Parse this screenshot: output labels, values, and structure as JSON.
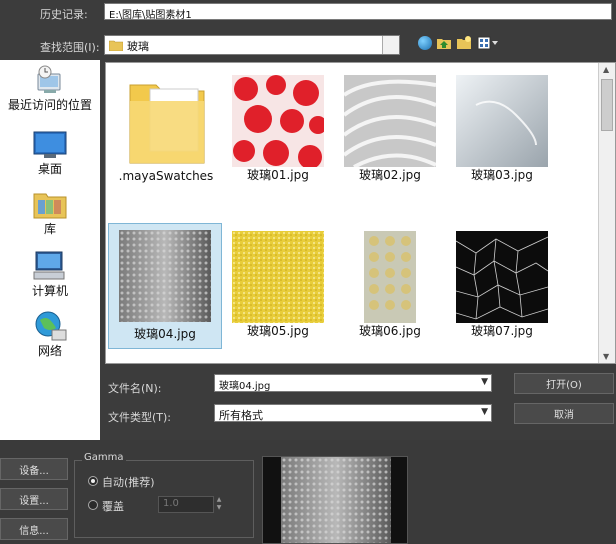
{
  "history": {
    "label": "历史记录:",
    "value": "E:\\图库\\贴图素材1"
  },
  "lookin": {
    "label": "查找范围(I):",
    "value": "玻璃"
  },
  "sidebar": {
    "items": [
      {
        "label": "最近访问的位置",
        "icon": "recent-places-icon"
      },
      {
        "label": "桌面",
        "icon": "desktop-icon"
      },
      {
        "label": "库",
        "icon": "library-icon"
      },
      {
        "label": "计算机",
        "icon": "computer-icon"
      },
      {
        "label": "网络",
        "icon": "network-icon"
      }
    ]
  },
  "files": [
    {
      "name": ".mayaSwatches",
      "kind": "folder"
    },
    {
      "name": "玻璃01.jpg",
      "kind": "image"
    },
    {
      "name": "玻璃02.jpg",
      "kind": "image"
    },
    {
      "name": "玻璃03.jpg",
      "kind": "image"
    },
    {
      "name": "玻璃04.jpg",
      "kind": "image",
      "selected": true
    },
    {
      "name": "玻璃05.jpg",
      "kind": "image"
    },
    {
      "name": "玻璃06.jpg",
      "kind": "image"
    },
    {
      "name": "玻璃07.jpg",
      "kind": "image"
    }
  ],
  "filename": {
    "label": "文件名(N):",
    "value": "玻璃04.jpg"
  },
  "filetype": {
    "label": "文件类型(T):",
    "value": "所有格式"
  },
  "buttons": {
    "open": "打开(O)",
    "cancel": "取消"
  },
  "bottom": {
    "setup1": "设备...",
    "setup2": "设置...",
    "info": "信息...",
    "gamma": {
      "title": "Gamma",
      "auto": "自动(推荐)",
      "override": "覆盖",
      "value": "1.0"
    }
  },
  "colors": {
    "accent_selection": "#cfe6f3",
    "dialog_bg": "#3c3c3c"
  }
}
